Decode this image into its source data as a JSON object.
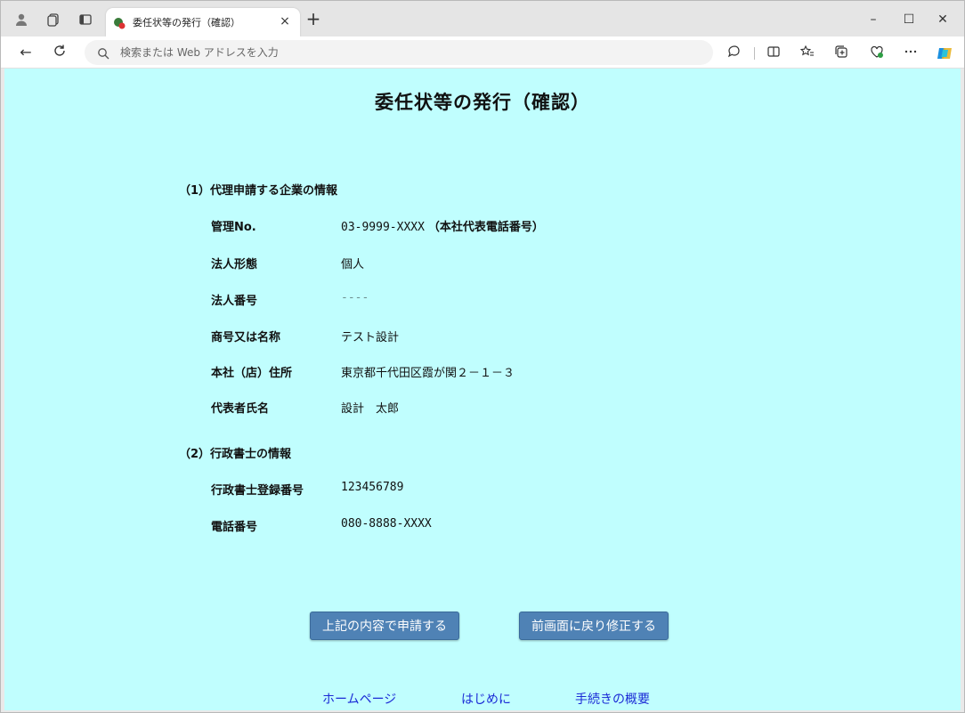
{
  "browser": {
    "tab": {
      "title": "委任状等の発行（確認）",
      "close": "×"
    },
    "new_tab": "+",
    "window_controls": {
      "minimize": "–",
      "maximize": "☐",
      "close": "✕"
    },
    "nav": {
      "back": "←",
      "refresh": "C"
    },
    "address_bar": {
      "placeholder": "検索または Web アドレスを入力"
    },
    "toolbar_icons": [
      "read-aloud-icon",
      "split-screen-icon",
      "favorites-icon",
      "collections-icon",
      "browser-essentials-icon",
      "more-icon",
      "copilot-icon"
    ]
  },
  "page": {
    "title": "委任状等の発行（確認）",
    "section1": {
      "heading": "（1）代理申請する企業の情報",
      "rows": [
        {
          "label": "管理No.",
          "value": "03-9999-XXXX",
          "note": "（本社代表電話番号）"
        },
        {
          "label": "法人形態",
          "value": "個人"
        },
        {
          "label": "法人番号",
          "value": "----"
        },
        {
          "label": "商号又は名称",
          "value": "テスト設計"
        },
        {
          "label": "本社（店）住所",
          "value": "東京都千代田区霞が関２－１－３"
        },
        {
          "label": "代表者氏名",
          "value": "設計　太郎"
        }
      ]
    },
    "section2": {
      "heading": "（2）行政書士の情報",
      "rows": [
        {
          "label": "行政書士登録番号",
          "value": "123456789"
        },
        {
          "label": "電話番号",
          "value": "080-8888-XXXX"
        }
      ]
    },
    "buttons": {
      "submit": "上記の内容で申請する",
      "back": "前画面に戻り修正する"
    },
    "footer_links": {
      "home": "ホームページ",
      "intro": "はじめに",
      "overview": "手続きの概要"
    }
  },
  "colors": {
    "page_background": "#c0fefe",
    "button": "#4f82b5",
    "link": "#1b2bd6"
  }
}
